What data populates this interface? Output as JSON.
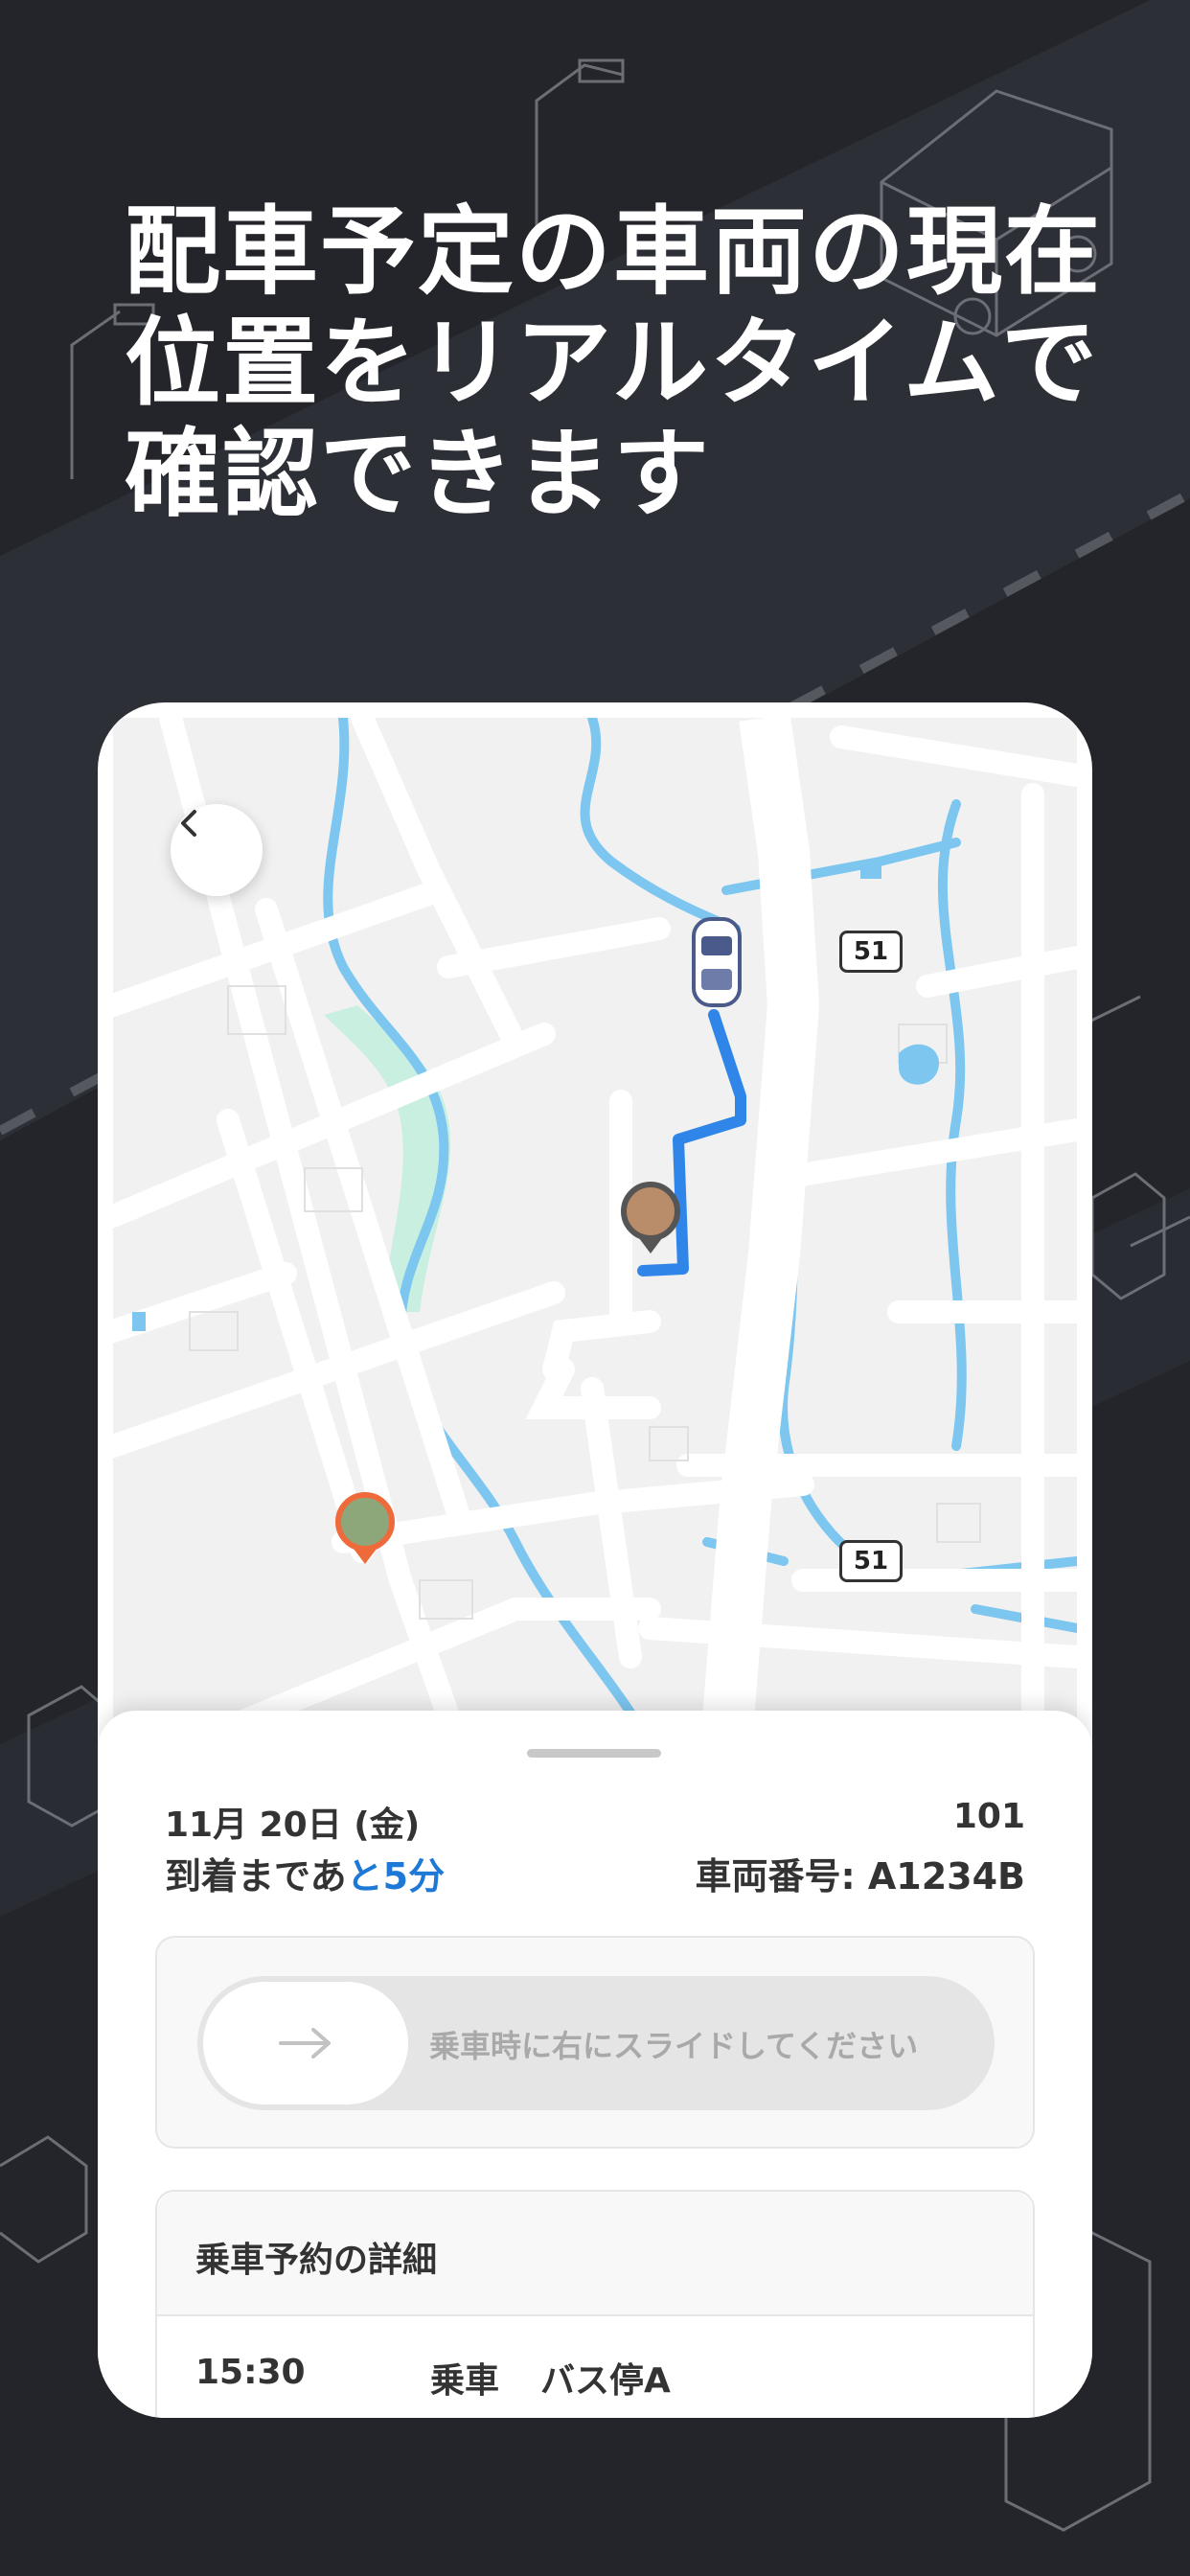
{
  "headline": {
    "line1": "配車予定の車両の現在",
    "line2": "位置をリアルタイムで",
    "line3": "確認できます"
  },
  "map": {
    "route_badges": [
      "51",
      "51"
    ],
    "colors": {
      "route": "#2f86e8",
      "river": "#7cc6f0",
      "park": "#c9efe1",
      "road": "#ffffff",
      "land": "#f1f1f1"
    },
    "icons": {
      "back": "chevron-left-icon",
      "vehicle": "car-icon",
      "pickup": "photo-pin-icon",
      "destination": "photo-pin-icon"
    }
  },
  "ride": {
    "date": "11月 20日 (金)",
    "bus_number": "101",
    "arrival_prefix": "到着まであ",
    "arrival_highlight": "と5分",
    "vehicle_label": "車両番号: A1234B",
    "slide_hint": "乗車時に右にスライドしてください"
  },
  "details": {
    "title": "乗車予約の詳細",
    "rows": [
      {
        "time": "15:30",
        "action": "乗車",
        "stop": "バス停A"
      }
    ]
  },
  "accent_color": "#1d78d6"
}
